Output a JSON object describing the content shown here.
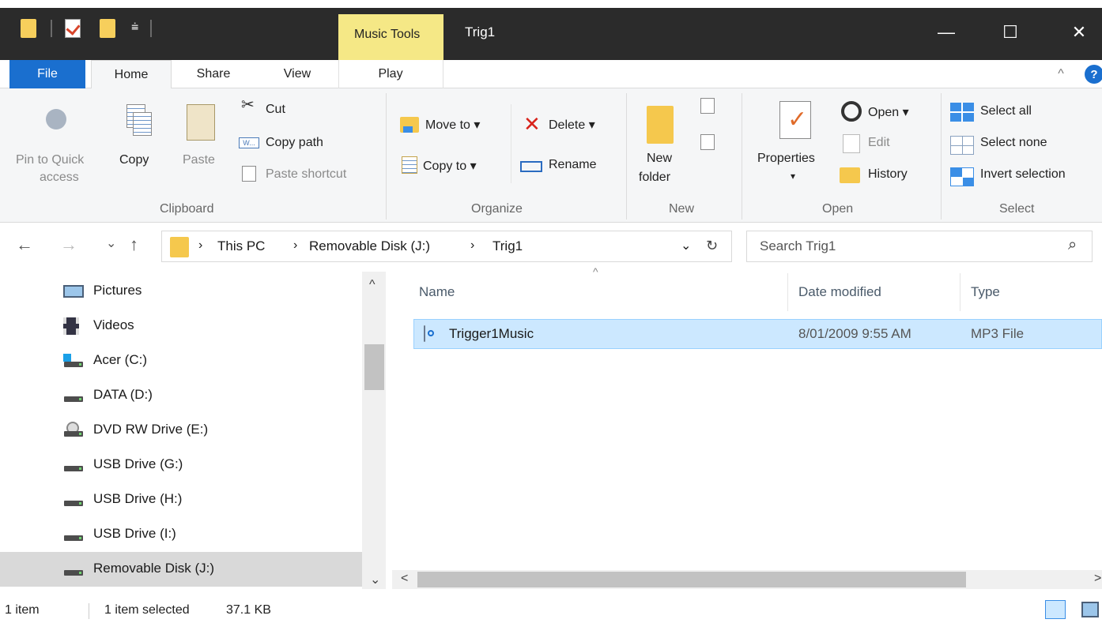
{
  "window": {
    "title": "Trig1",
    "contextual_tab": "Music Tools",
    "controls": {
      "minimize": "—",
      "maximize": "☐",
      "close": "✕"
    }
  },
  "tabs": {
    "file": "File",
    "home": "Home",
    "share": "Share",
    "view": "View",
    "play": "Play",
    "collapse": "^",
    "help": "?"
  },
  "ribbon": {
    "clipboard": {
      "pin_line1": "Pin to Quick",
      "pin_line2": "access",
      "copy": "Copy",
      "paste": "Paste",
      "cut": "Cut",
      "copy_path": "Copy path",
      "paste_shortcut": "Paste shortcut",
      "group": "Clipboard"
    },
    "organize": {
      "move_to": "Move to ▾",
      "copy_to": "Copy to ▾",
      "delete": "Delete ▾",
      "rename": "Rename",
      "group": "Organize"
    },
    "new": {
      "new_folder_line1": "New",
      "new_folder_line2": "folder",
      "group": "New"
    },
    "open": {
      "properties": "Properties",
      "properties_arrow": "▾",
      "open": "Open ▾",
      "edit": "Edit",
      "history": "History",
      "group": "Open"
    },
    "select": {
      "select_all": "Select all",
      "select_none": "Select none",
      "invert": "Invert selection",
      "group": "Select"
    }
  },
  "address": {
    "back": "←",
    "forward": "→",
    "recent": "⌄",
    "up": "↑",
    "sep": "›",
    "crumbs": [
      "This PC",
      "Removable Disk (J:)",
      "Trig1"
    ],
    "dropdown": "⌄",
    "refresh": "↻",
    "search_placeholder": "Search Trig1",
    "search_icon": "⌕"
  },
  "nav_pane": {
    "items": [
      "Pictures",
      "Videos",
      "Acer (C:)",
      "DATA (D:)",
      "DVD RW Drive (E:)",
      "USB Drive (G:)",
      "USB Drive (H:)",
      "USB Drive (I:)",
      "Removable Disk (J:)"
    ],
    "selected_index": 8,
    "scroll_up": "^",
    "scroll_down": "⌄"
  },
  "file_list": {
    "columns": [
      "Name",
      "Date modified",
      "Type"
    ],
    "sort_indicator": "^",
    "rows": [
      {
        "name": "Trigger1Music",
        "date": "8/01/2009 9:55 AM",
        "type": "MP3 File",
        "selected": true
      }
    ],
    "scroll_left": "<",
    "scroll_right": ">"
  },
  "status": {
    "count": "1 item",
    "selected": "1 item selected",
    "size": "37.1 KB"
  },
  "colors": {
    "file_tab": "#1a6fcf",
    "music_tools": "#f5e886",
    "selection": "#cce8ff",
    "titlebar": "#2b2b2b"
  }
}
